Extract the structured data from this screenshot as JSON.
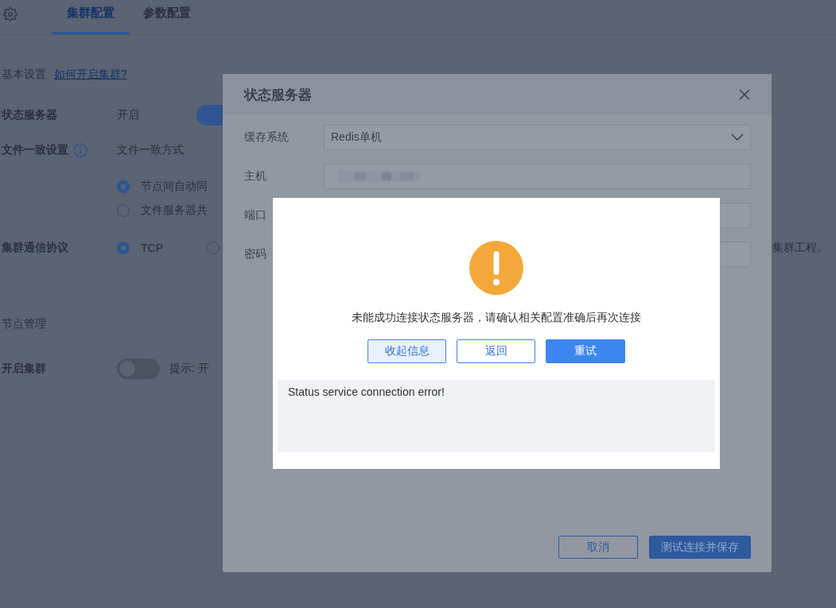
{
  "page": {
    "tabs": [
      {
        "label": "集群配置",
        "selected": true
      },
      {
        "label": "参数配置",
        "selected": false
      }
    ],
    "basic_settings": {
      "title": "基本设置",
      "help_link": "如何开启集群?"
    },
    "state_server": {
      "label": "状态服务器",
      "value": "开启",
      "on": true
    },
    "file_consistency": {
      "label": "文件一致设置",
      "placeholder": "文件一致方式",
      "options": [
        {
          "label": "节点间自动同",
          "selected": true
        },
        {
          "label": "文件服务器共",
          "selected": false
        }
      ]
    },
    "protocol": {
      "label": "集群通信协议",
      "options": [
        {
          "label": "TCP",
          "selected": true
        },
        {
          "selected": false
        }
      ],
      "note": "集群工程。"
    },
    "node_management": {
      "title": "节点管理"
    },
    "enable_cluster": {
      "label": "开启集群",
      "on": false,
      "hint": "提示: 开"
    }
  },
  "dialog": {
    "title": "状态服务器",
    "fields": [
      {
        "label": "缓存系统",
        "kind": "select",
        "value": "Redis单机"
      },
      {
        "label": "主机",
        "kind": "masked"
      },
      {
        "label": "端口",
        "kind": "input"
      },
      {
        "label": "密码",
        "kind": "input"
      }
    ],
    "buttons": [
      {
        "label": "取消",
        "kind": "secondary"
      },
      {
        "label": "测试连接并保存",
        "kind": "primary"
      }
    ]
  },
  "alert": {
    "message": "未能成功连接状态服务器，请确认相关配置准确后再次连接",
    "buttons": [
      {
        "label": "收起信息",
        "kind": "toggle"
      },
      {
        "label": "返回",
        "kind": "secondary"
      },
      {
        "label": "重试",
        "kind": "primary"
      }
    ],
    "details": "Status service connection error!"
  }
}
